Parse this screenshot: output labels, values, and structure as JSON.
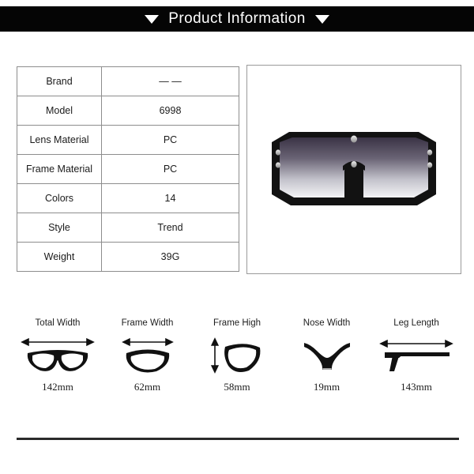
{
  "header": {
    "title": "Product Information",
    "left_marker": "triangle-down",
    "right_marker": "triangle-down",
    "background_color": "#050505",
    "text_color": "#ffffff"
  },
  "spec_table": {
    "rows": [
      {
        "key": "Brand",
        "value": "— —"
      },
      {
        "key": "Model",
        "value": "6998"
      },
      {
        "key": "Lens Material",
        "value": "PC"
      },
      {
        "key": "Frame Material",
        "value": "PC"
      },
      {
        "key": "Colors",
        "value": "14"
      },
      {
        "key": "Style",
        "value": "Trend"
      },
      {
        "key": "Weight",
        "value": "39G"
      }
    ]
  },
  "product_image": {
    "alt": "oversized shield sunglasses",
    "frame_color": "#121212",
    "lens_top_color": "#3b3446",
    "lens_bottom_color": "#f2f2f4",
    "rivet_color": "#c9c9c9"
  },
  "measurements": [
    {
      "label": "Total Width",
      "value": "142mm",
      "icon": "full-frame-horizontal-arrow-icon"
    },
    {
      "label": "Frame Width",
      "value": "62mm",
      "icon": "single-lens-horizontal-arrow-icon"
    },
    {
      "label": "Frame High",
      "value": "58mm",
      "icon": "single-lens-vertical-arrow-icon"
    },
    {
      "label": "Nose Width",
      "value": "19mm",
      "icon": "nose-bridge-icon"
    },
    {
      "label": "Leg Length",
      "value": "143mm",
      "icon": "temple-arm-horizontal-arrow-icon"
    }
  ],
  "divider": {
    "color": "#2b2b2b"
  }
}
